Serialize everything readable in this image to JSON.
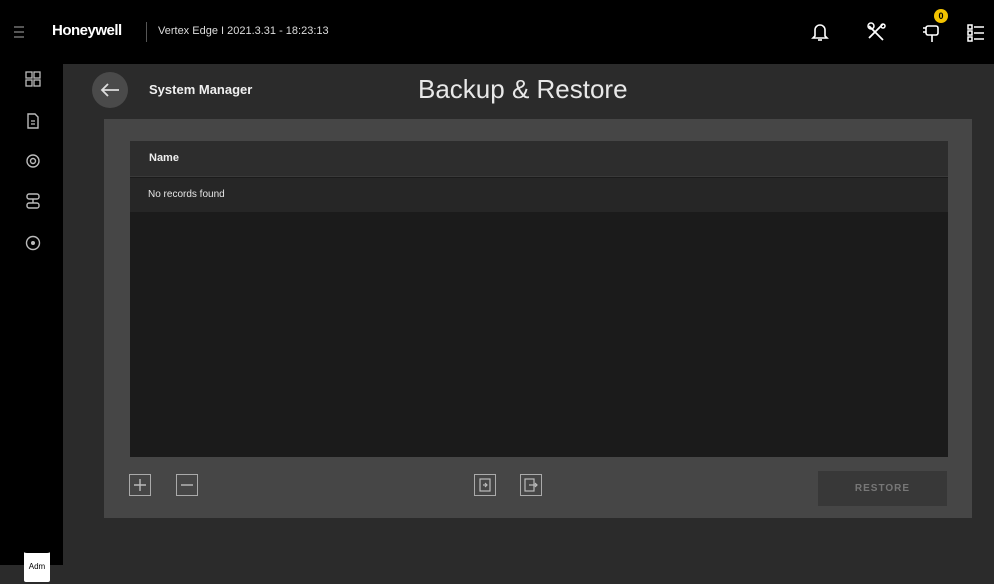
{
  "topbar": {
    "brand": "Honeywell",
    "breadcrumb": "Vertex Edge I 2021.3.31 - 18:23:13",
    "notification_badge": "0"
  },
  "header": {
    "section": "System Manager",
    "title": "Backup & Restore"
  },
  "table": {
    "columns": [
      "Name"
    ],
    "empty_message": "No records found"
  },
  "actions": {
    "restore_label": "RESTORE"
  },
  "user": {
    "avatar_label": "Adm"
  },
  "icons": {
    "back": "arrow-left-icon",
    "alert": "bell-icon",
    "tools": "tools-icon",
    "devices": "device-tree-icon",
    "more": "list-icon",
    "nav": [
      "grid-icon",
      "document-icon",
      "settings-icon",
      "network-icon",
      "help-icon"
    ],
    "toolbar": [
      "add-icon",
      "remove-icon",
      "import-icon",
      "export-icon"
    ]
  }
}
